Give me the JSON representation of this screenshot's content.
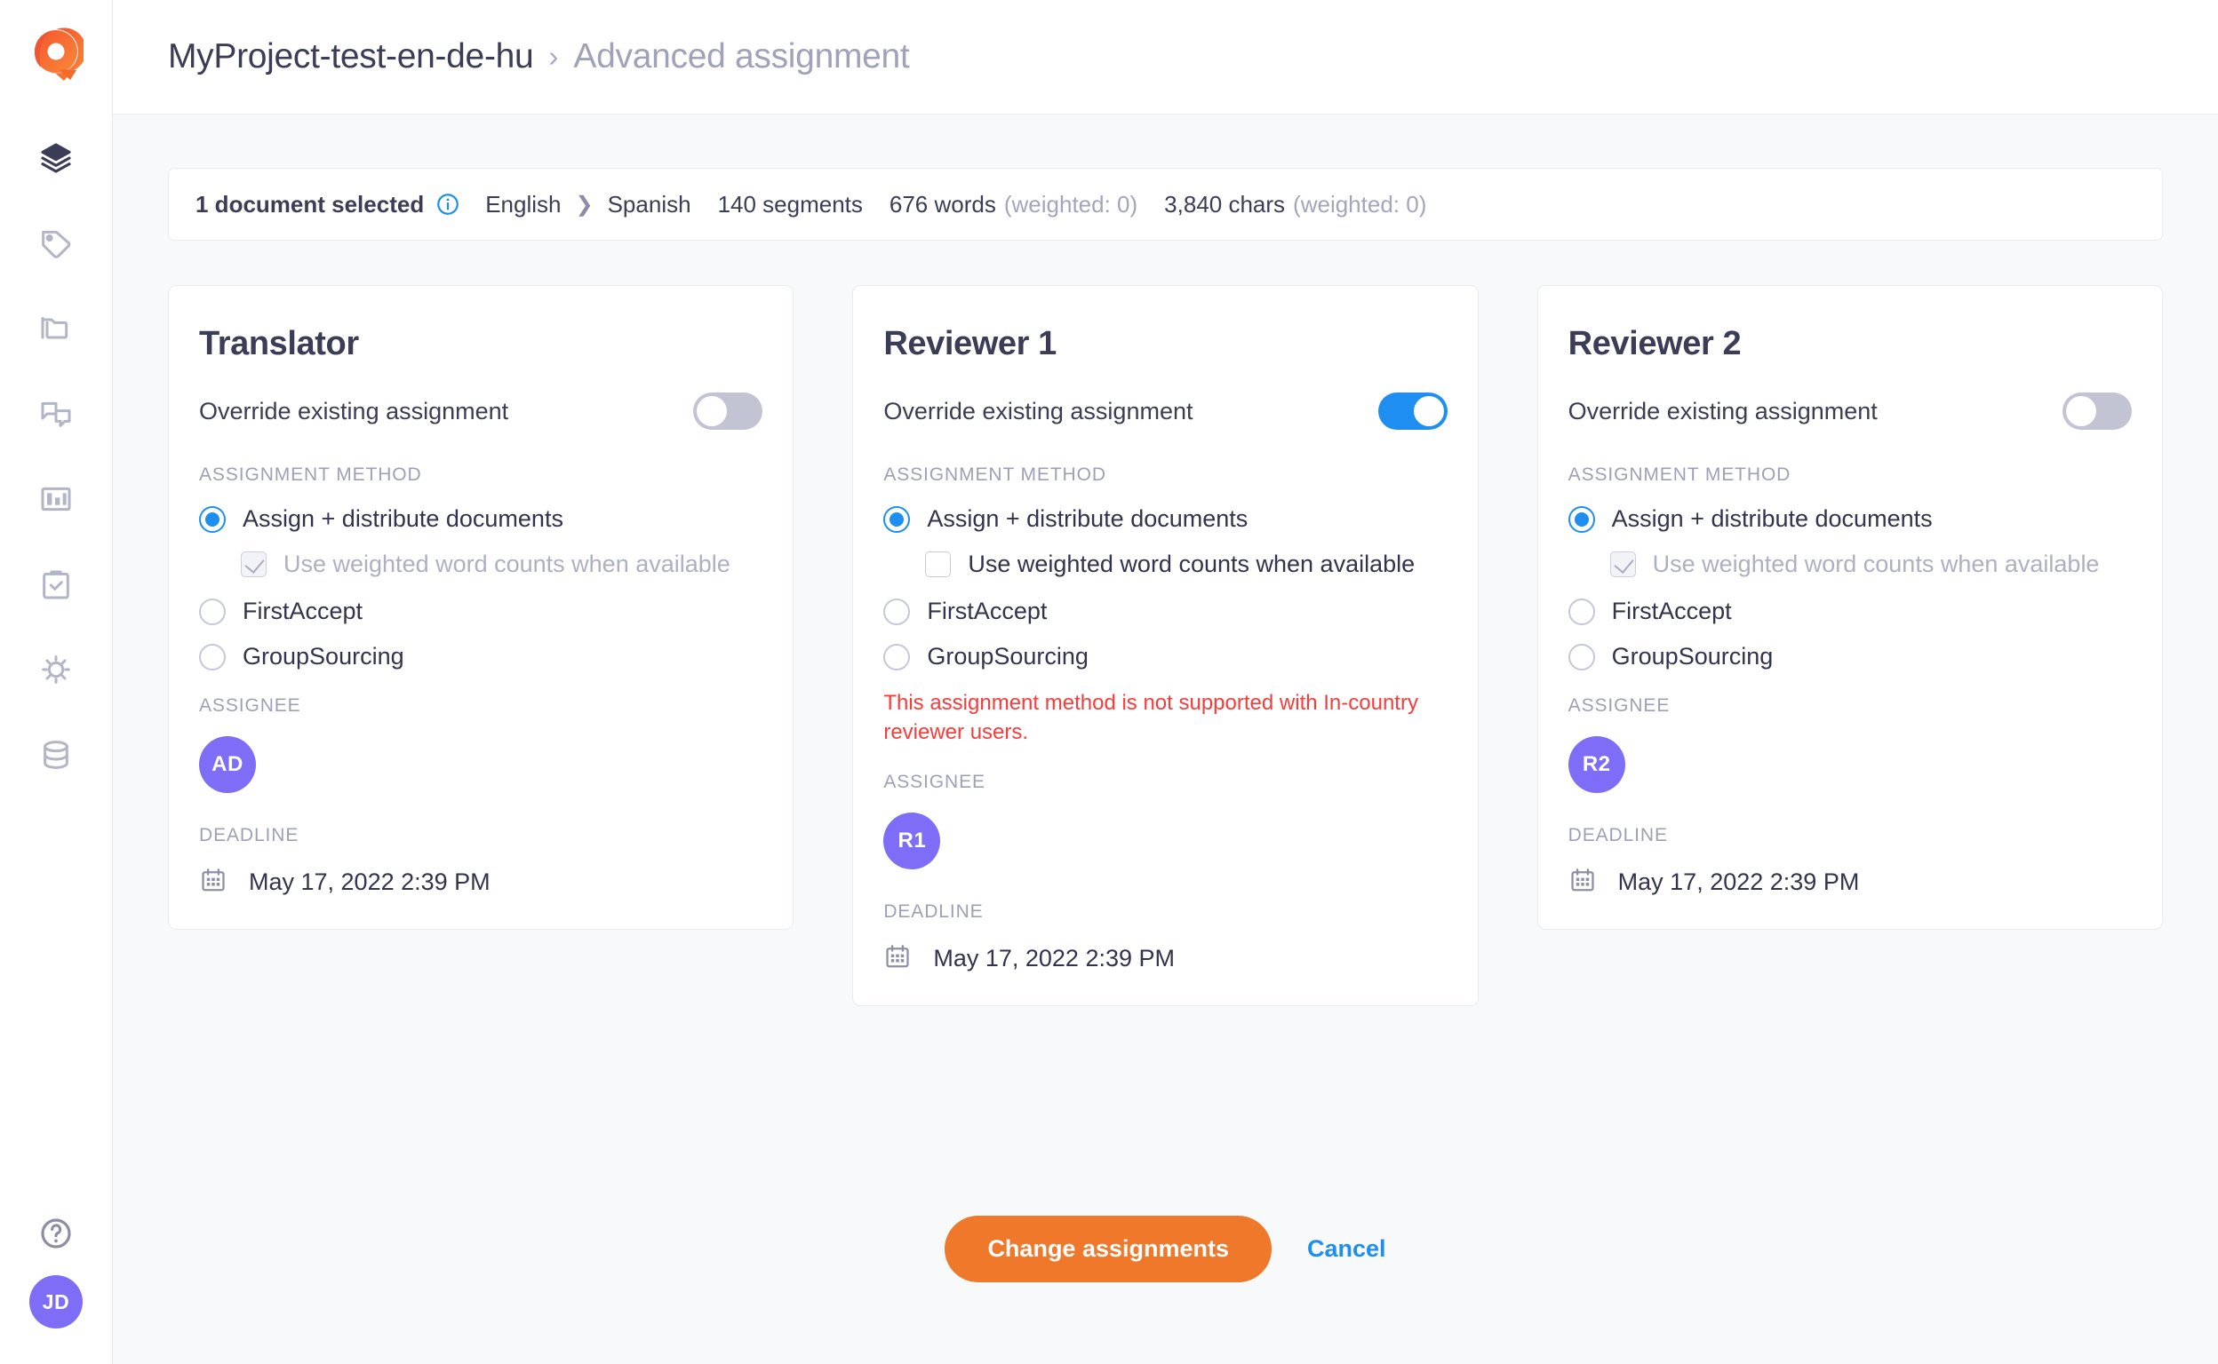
{
  "brand": {
    "logo_icon": "q-logo-icon",
    "accent_orange": "#F0782A",
    "accent_blue": "#1E8FF0",
    "avatar_purple": "#7E6DF6",
    "error_red": "#FB3A3A"
  },
  "sidebar": {
    "items": [
      {
        "icon": "layers-icon",
        "active": true
      },
      {
        "icon": "tag-icon",
        "active": false
      },
      {
        "icon": "folder-icon",
        "active": false
      },
      {
        "icon": "chat-bubbles-icon",
        "active": false
      },
      {
        "icon": "bar-chart-icon",
        "active": false
      },
      {
        "icon": "clipboard-check-icon",
        "active": false
      },
      {
        "icon": "gear-icon",
        "active": false
      },
      {
        "icon": "database-icon",
        "active": false
      }
    ],
    "bottom": {
      "help_icon": "question-circle-icon",
      "user_initials": "JD"
    }
  },
  "header": {
    "breadcrumb": {
      "project": "MyProject-test-en-de-hu",
      "separator": "›",
      "current": "Advanced assignment"
    }
  },
  "infobar": {
    "selection": "1 document selected",
    "info_icon": "info-circle-icon",
    "source_language": "English",
    "language_separator": "❯",
    "target_language": "Spanish",
    "segments": "140 segments",
    "words": "676 words",
    "words_weighted": "(weighted: 0)",
    "chars": "3,840 chars",
    "chars_weighted": "(weighted: 0)"
  },
  "labels": {
    "override": "Override existing assignment",
    "assignment_method": "ASSIGNMENT METHOD",
    "assignee": "ASSIGNEE",
    "deadline": "DEADLINE",
    "weighted_checkbox": "Use weighted word counts when available",
    "calendar_icon": "calendar-icon"
  },
  "cards": [
    {
      "title": "Translator",
      "override_on": false,
      "methods": [
        {
          "label": "Assign + distribute documents",
          "checked": true
        },
        {
          "label": "FirstAccept",
          "checked": false
        },
        {
          "label": "GroupSourcing",
          "checked": false
        }
      ],
      "weighted_checked": true,
      "weighted_disabled": true,
      "error": "",
      "assignee_initials": "AD",
      "deadline_value": "May 17, 2022 2:39 PM"
    },
    {
      "title": "Reviewer 1",
      "override_on": true,
      "methods": [
        {
          "label": "Assign + distribute documents",
          "checked": true
        },
        {
          "label": "FirstAccept",
          "checked": false
        },
        {
          "label": "GroupSourcing",
          "checked": false
        }
      ],
      "weighted_checked": false,
      "weighted_disabled": false,
      "error": "This assignment method is not supported with In-country reviewer users.",
      "assignee_initials": "R1",
      "deadline_value": "May 17, 2022 2:39 PM"
    },
    {
      "title": "Reviewer 2",
      "override_on": false,
      "methods": [
        {
          "label": "Assign + distribute documents",
          "checked": true
        },
        {
          "label": "FirstAccept",
          "checked": false
        },
        {
          "label": "GroupSourcing",
          "checked": false
        }
      ],
      "weighted_checked": true,
      "weighted_disabled": true,
      "error": "",
      "assignee_initials": "R2",
      "deadline_value": "May 17, 2022 2:39 PM"
    }
  ],
  "footer": {
    "primary_label": "Change assignments",
    "cancel_label": "Cancel"
  }
}
